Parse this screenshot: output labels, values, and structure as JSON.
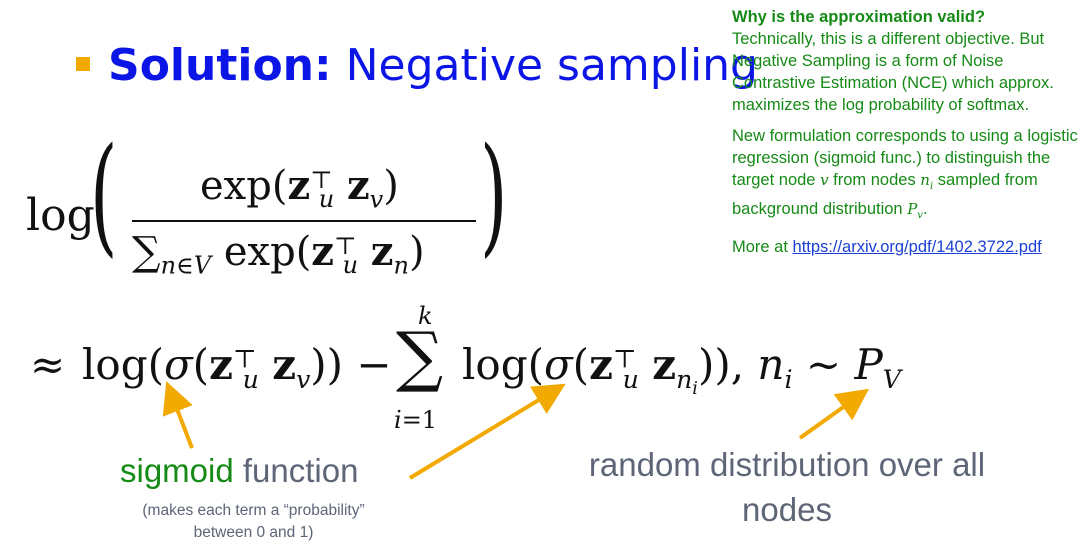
{
  "title": {
    "bold": "Solution:",
    "rest": "Negative sampling"
  },
  "note": {
    "heading": "Why is the approximation valid?",
    "para1": "Technically, this is a different objective. But Negative Sampling is a form of Noise Contrastive Estimation (NCE) which approx. maximizes the log probability of softmax.",
    "para2_a": "New formulation corresponds to using a logistic regression (sigmoid func.) to distinguish the target node",
    "para2_b": "from nodes",
    "para2_c": "sampled from background distribution",
    "more_label": "More at",
    "link": "https://arxiv.org/pdf/1402.3722.pdf"
  },
  "annotations": {
    "sigmoid_word": "sigmoid",
    "function_word": "function",
    "sigmoid_note": "(makes each term a “probability” between 0 and 1)",
    "random_label": "random distribution over all nodes"
  },
  "colors": {
    "title_blue": "#0b16e6",
    "bullet": "#f2a900",
    "note_green": "#168a16",
    "arrow": "#f2a900",
    "gray": "#5d6577",
    "link": "#1a3fd6"
  }
}
